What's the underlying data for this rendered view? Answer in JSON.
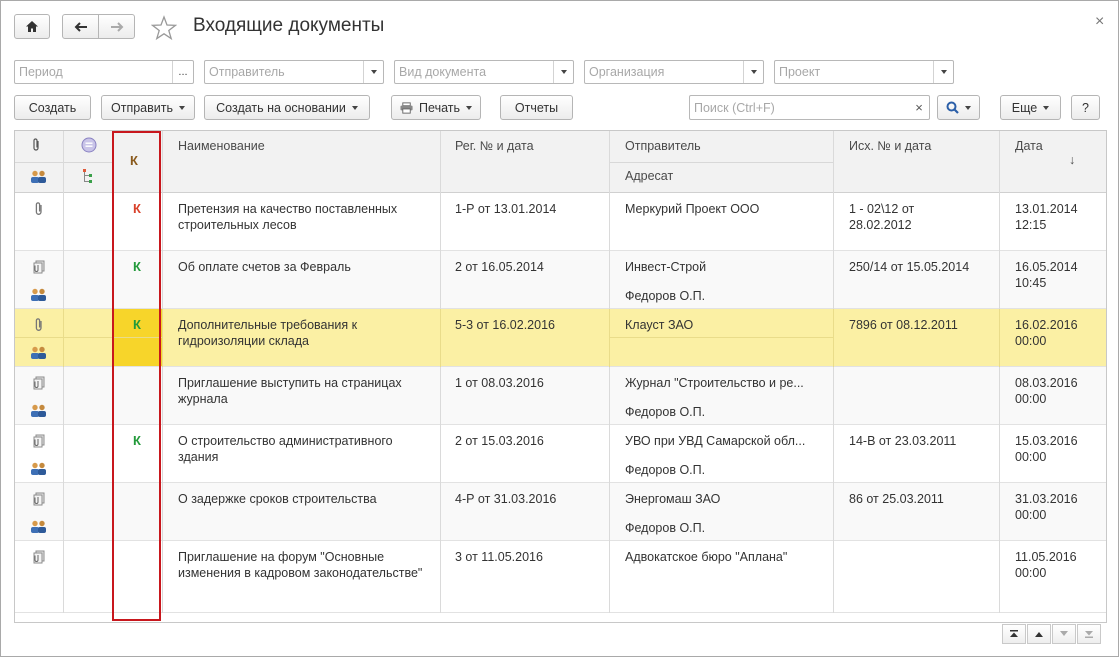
{
  "window": {
    "title": "Входящие документы",
    "close_glyph": "×"
  },
  "nav": {
    "home_icon": "home-icon",
    "back_icon": "arrow-left-icon",
    "forward_icon": "arrow-right-icon",
    "favorite_icon": "star-icon"
  },
  "filters": {
    "period_placeholder": "Период",
    "period_button": "...",
    "sender_placeholder": "Отправитель",
    "doctype_placeholder": "Вид документа",
    "org_placeholder": "Организация",
    "project_placeholder": "Проект"
  },
  "toolbar": {
    "create": "Создать",
    "send": "Отправить",
    "create_based": "Создать на основании",
    "print": "Печать",
    "reports": "Отчеты",
    "search_placeholder": "Поиск (Ctrl+F)",
    "search_clear": "×",
    "more": "Еще",
    "help": "?"
  },
  "columns": {
    "k": "К",
    "name": "Наименование",
    "reg": "Рег. № и дата",
    "sender": "Отправитель",
    "addressee": "Адресат",
    "out": "Исх. № и дата",
    "date": "Дата",
    "sort_arrow": "↓"
  },
  "rows": [
    {
      "attach": "paperclip",
      "k": "К",
      "k_color": "red",
      "name": "Претензия на качество поставленных строительных лесов",
      "reg": "1-Р от 13.01.2014",
      "sender": "Меркурий Проект ООО",
      "addressee": "",
      "out": "1 - 02\\12 от 28.02.2012",
      "date": "13.01.2014",
      "time": "12:15",
      "selected": false
    },
    {
      "attach": "scan",
      "k": "К",
      "k_color": "green",
      "name": "Об оплате счетов за Февраль",
      "reg": "2 от 16.05.2014",
      "sender": "Инвест-Строй",
      "addressee": "Федоров О.П.",
      "out": "250/14 от 15.05.2014",
      "date": "16.05.2014",
      "time": "10:45",
      "selected": false
    },
    {
      "attach": "paperclip",
      "k": "К",
      "k_color": "green",
      "name": "Дополнительные требования к гидроизоляции склада",
      "reg": "5-3 от 16.02.2016",
      "sender": "Клауст ЗАО",
      "addressee": "",
      "out": "7896 от 08.12.2011",
      "date": "16.02.2016",
      "time": "00:00",
      "selected": true
    },
    {
      "attach": "scan",
      "k": "",
      "k_color": "",
      "name": "Приглашение выступить на страницах журнала",
      "reg": "1 от 08.03.2016",
      "sender": "Журнал \"Строительство и ре...",
      "addressee": "Федоров О.П.",
      "out": "",
      "date": "08.03.2016",
      "time": "00:00",
      "selected": false
    },
    {
      "attach": "scan",
      "k": "К",
      "k_color": "green",
      "name": "О строительство административного здания",
      "reg": "2 от 15.03.2016",
      "sender": "УВО при УВД Самарской обл...",
      "addressee": "Федоров О.П.",
      "out": "14-В от 23.03.2011",
      "date": "15.03.2016",
      "time": "00:00",
      "selected": false
    },
    {
      "attach": "scan",
      "k": "",
      "k_color": "",
      "name": "О задержке сроков строительства",
      "reg": "4-Р от 31.03.2016",
      "sender": "Энергомаш ЗАО",
      "addressee": "Федоров О.П.",
      "out": "86 от 25.03.2011",
      "date": "31.03.2016",
      "time": "00:00",
      "selected": false
    },
    {
      "attach": "scan",
      "k": "",
      "k_color": "",
      "name": "Приглашение на форум \"Основные изменения в кадровом законодательстве\"",
      "reg": "3 от 11.05.2016",
      "sender": "Адвокатское бюро \"Аплана\"",
      "addressee": "",
      "out": "",
      "date": "11.05.2016",
      "time": "00:00",
      "selected": false
    }
  ],
  "colors": {
    "k_red": "#d9412b",
    "k_green": "#239a3b",
    "selected_row": "#fbf0a4",
    "highlight_box": "#c8171d"
  }
}
